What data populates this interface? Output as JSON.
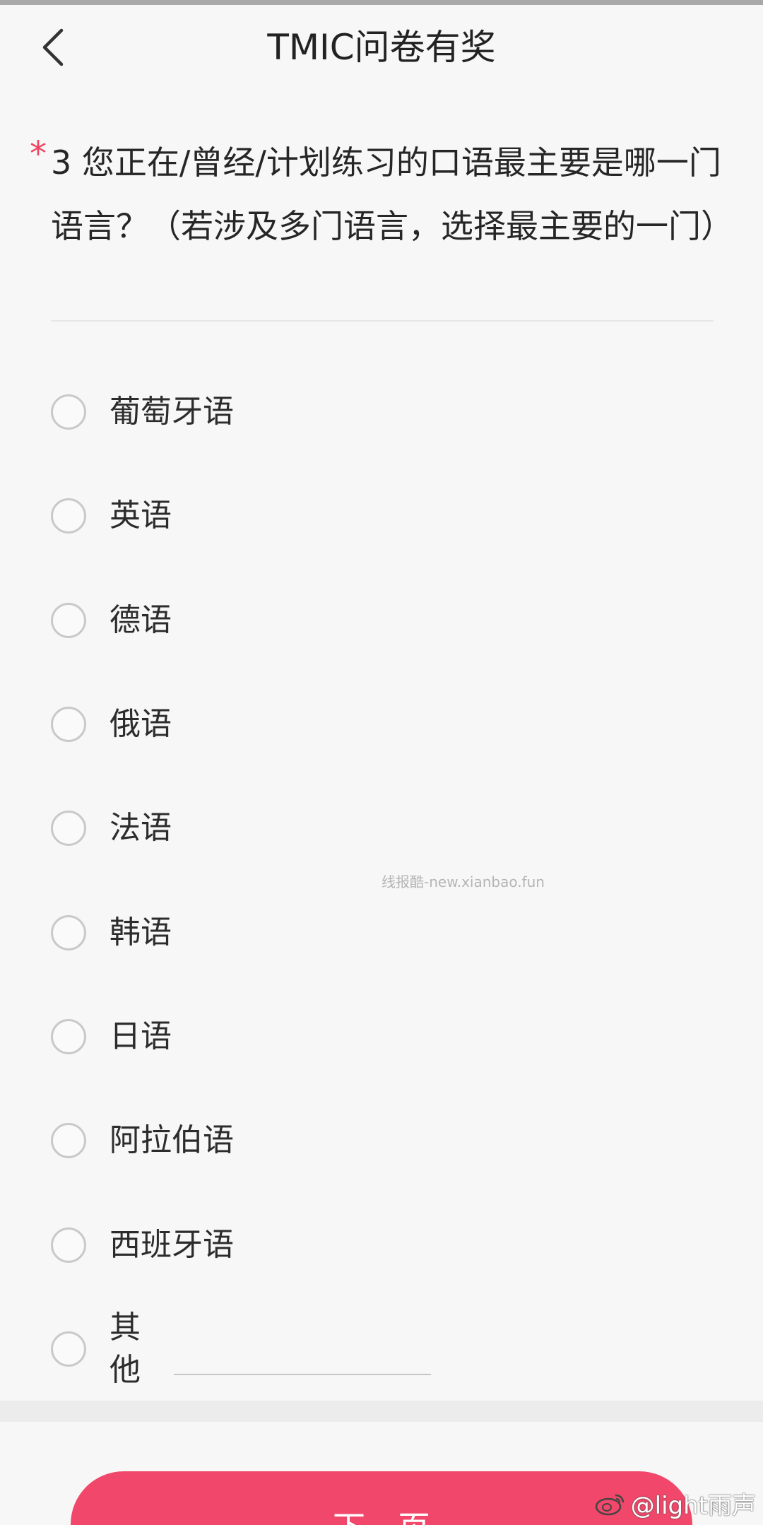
{
  "header": {
    "title": "TMIC问卷有奖",
    "back_icon": "chevron-left-icon"
  },
  "question": {
    "required_mark": "*",
    "text": "3 您正在/曾经/计划练习的口语最主要是哪一门语言？（若涉及多门语言，选择最主要的一门）"
  },
  "options": [
    {
      "label": "葡萄牙语",
      "selected": false
    },
    {
      "label": "英语",
      "selected": false
    },
    {
      "label": "德语",
      "selected": false
    },
    {
      "label": "俄语",
      "selected": false
    },
    {
      "label": "法语",
      "selected": false
    },
    {
      "label": "韩语",
      "selected": false
    },
    {
      "label": "日语",
      "selected": false
    },
    {
      "label": "阿拉伯语",
      "selected": false
    },
    {
      "label": "西班牙语",
      "selected": false
    },
    {
      "label": "其他",
      "selected": false
    }
  ],
  "other_input": {
    "value": "",
    "placeholder": ""
  },
  "watermark": "线报酷-new.xianbao.fun",
  "footer": {
    "next_label": "下一页"
  },
  "corner_watermark": {
    "text": "@light雨声",
    "icon": "weibo-icon"
  },
  "colors": {
    "accent": "#f1476a",
    "required": "#ee4561",
    "background": "#f7f7f7"
  }
}
